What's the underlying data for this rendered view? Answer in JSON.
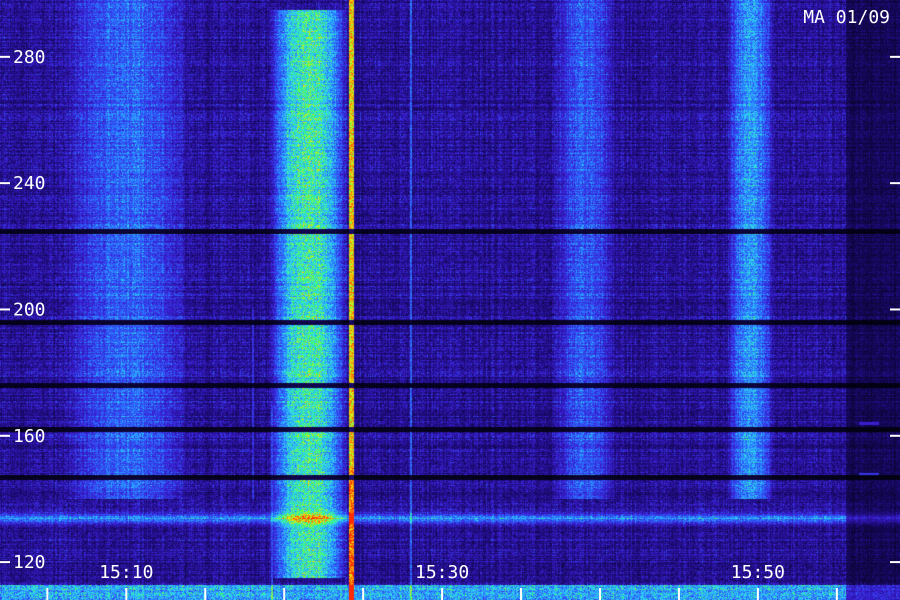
{
  "chart_data": {
    "type": "heatmap",
    "station_label": "MA 01/09",
    "x_unit": "UT",
    "x_range": [
      "15:02",
      "15:59"
    ],
    "x_labeled_ticks": [
      "15:10",
      "15:30",
      "15:50"
    ],
    "x_minor_tick_minutes": 5,
    "y_range": [
      108,
      298
    ],
    "y_ticks": [
      120,
      160,
      200,
      240,
      280
    ],
    "colormap": [
      "#000008",
      "#1a0a6e",
      "#3b1ed6",
      "#2a6cff",
      "#2fd0ff",
      "#3cff6a",
      "#ffe600",
      "#ff2a00"
    ],
    "features": [
      {
        "kind": "broadband_emission",
        "x_start": "15:19",
        "x_end": "15:24",
        "y_range": [
          115,
          295
        ],
        "level": 0.55
      },
      {
        "kind": "narrow_vertical_line",
        "x": "15:24.2",
        "y_range": [
          108,
          298
        ],
        "level": 0.95
      },
      {
        "kind": "faint_vertical_line",
        "x": "15:28",
        "y_range": [
          108,
          298
        ],
        "level": 0.45
      },
      {
        "kind": "faint_vertical_line",
        "x": "15:19.2",
        "y_range": [
          108,
          170
        ],
        "level": 0.4
      },
      {
        "kind": "faint_vertical_line",
        "x": "15:18",
        "y_range": [
          140,
          200
        ],
        "level": 0.35
      },
      {
        "kind": "broadband_emission",
        "x_start": "15:48",
        "x_end": "15:51",
        "y_range": [
          140,
          298
        ],
        "level": 0.35
      },
      {
        "kind": "broadband_emission",
        "x_start": "15:06",
        "x_end": "15:14",
        "y_range": [
          140,
          298
        ],
        "level": 0.25
      },
      {
        "kind": "broadband_emission",
        "x_start": "15:37",
        "x_end": "15:41",
        "y_range": [
          140,
          298
        ],
        "level": 0.22
      },
      {
        "kind": "horizontal_band",
        "y": 134,
        "x_start": "15:02",
        "x_end": "15:59",
        "level": 0.35
      },
      {
        "kind": "horizontal_dark",
        "y": 147,
        "level": 0.0
      },
      {
        "kind": "horizontal_dark",
        "y": 162,
        "level": 0.0
      },
      {
        "kind": "horizontal_dark",
        "y": 176,
        "level": 0.0
      },
      {
        "kind": "horizontal_dark",
        "y": 196,
        "level": 0.0
      },
      {
        "kind": "horizontal_dark",
        "y": 225,
        "level": 0.0
      },
      {
        "kind": "low_freq_bright_band",
        "y_range": [
          108,
          113
        ],
        "level": 0.4
      },
      {
        "kind": "short_tone",
        "x": "15:57",
        "y": 148,
        "level": 0.6
      },
      {
        "kind": "short_tone",
        "x": "15:57",
        "y": 164,
        "level": 0.5
      }
    ],
    "grid": false,
    "legend": "none",
    "title": "",
    "xlabel": "",
    "ylabel": ""
  }
}
